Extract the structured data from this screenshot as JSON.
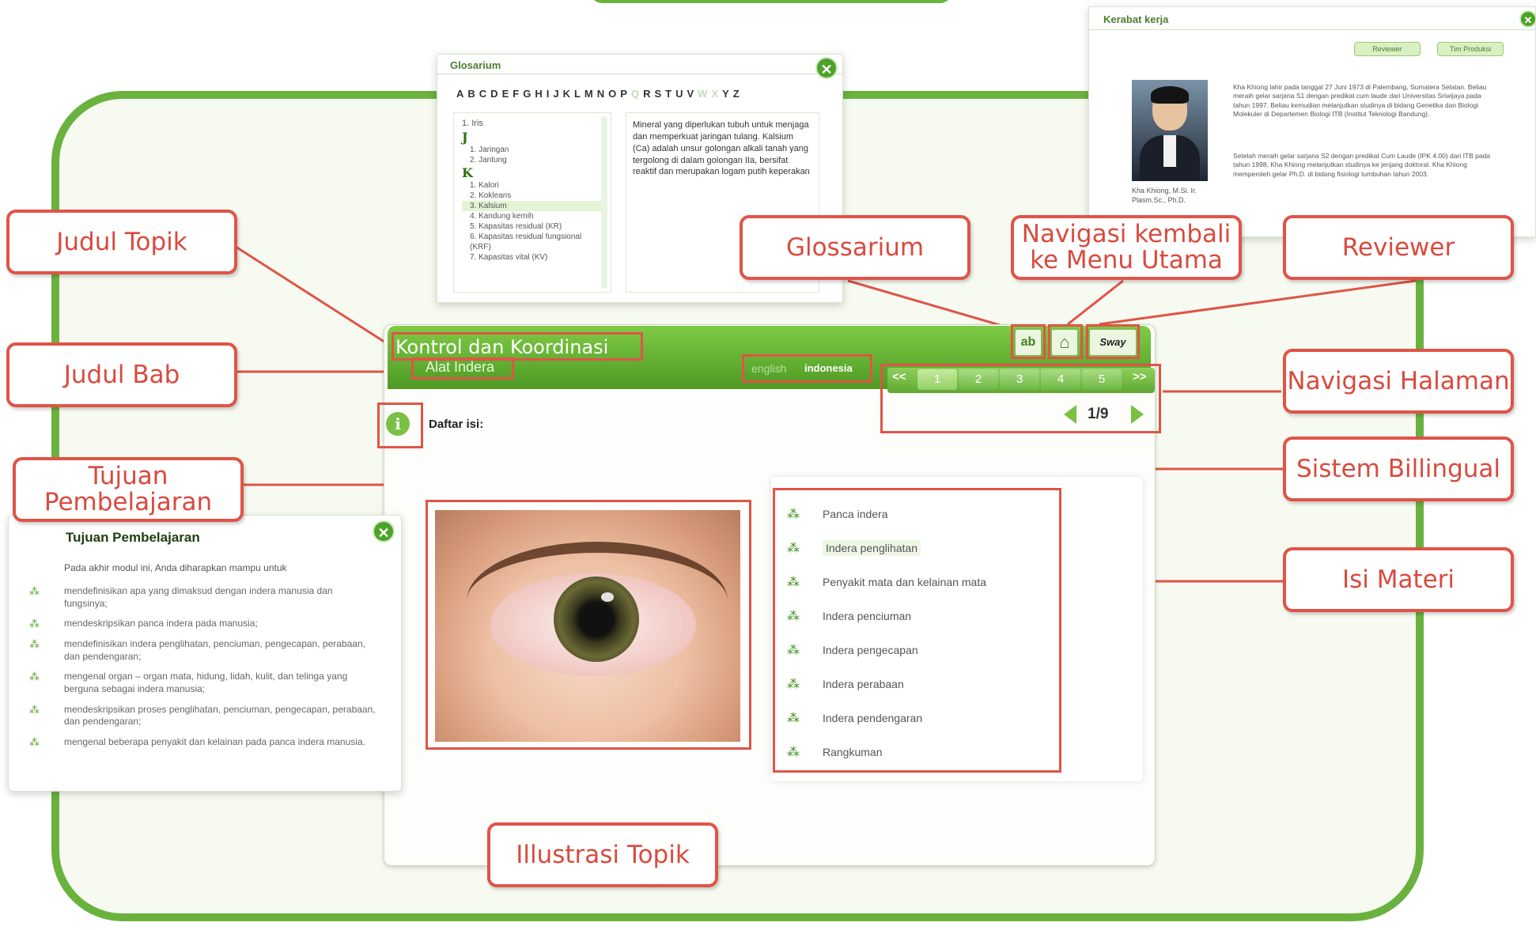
{
  "callouts": {
    "judul_topik": "Judul Topik",
    "judul_bab": "Judul Bab",
    "tujuan": "Tujuan Pembelajaran",
    "glossarium": "Glossarium",
    "navigasi_menu": "Navigasi kembali ke Menu Utama",
    "reviewer": "Reviewer",
    "navigasi_halaman": "Navigasi Halaman",
    "sistem_bilingual": "Sistem Billingual",
    "isi_materi": "Isi Materi",
    "ilustrasi": "Illustrasi Topik"
  },
  "glosarium": {
    "title": "Glosarium",
    "letters": [
      "A",
      "B",
      "C",
      "D",
      "E",
      "F",
      "G",
      "H",
      "I",
      "J",
      "K",
      "L",
      "M",
      "N",
      "O",
      "P",
      "Q",
      "R",
      "S",
      "T",
      "U",
      "V",
      "W",
      "X",
      "Y",
      "Z"
    ],
    "list_top": "1. Iris",
    "group_j": "J",
    "j_items": [
      "1. Jaringan",
      "2. Jantung"
    ],
    "group_k": "K",
    "k_items": [
      "1. Kalori",
      "2. Koklearis",
      "3. Kalsium",
      "4. Kandung kemih",
      "5. Kapasitas residual (KR)",
      "6. Kapasitas residual fungsional (KRF)",
      "7. Kapasitas vital (KV)"
    ],
    "definition": "Mineral yang diperlukan tubuh untuk menjaga dan memperkuat jaringan tulang. Kalsium (Ca) adalah unsur golongan alkali tanah yang tergolong di dalam golongan IIa, bersifat reaktif dan merupakan logam putih keperakan"
  },
  "kerabat": {
    "title": "Kerabat kerja",
    "btn1": "Reviewer",
    "btn2": "Tim Produksi",
    "caption": "Kha Khiong, M.Si. Ir. Plasm.Sc., Ph.D.",
    "bio1": "Kha Khiong lahir pada tanggal 27 Juni 1973 di Palembang, Sumatera Selatan. Beliau meraih gelar sarjana S1 dengan predikat cum laude dari Universitas Sriwijaya pada tahun 1997. Beliau kemudian melanjutkan studinya di bidang Genetika dan Biologi Molekuler di Departemen Biologi ITB (Institut Teknologi Bandung).",
    "bio2": "Setelah meraih gelar sarjana S2 dengan predikat Cum Laude (IPK 4.00) dari ITB pada tahun 1998, Kha Khiong melanjutkan studinya ke jenjang doktoral. Kha Khiong memperoleh gelar Ph.D. di bidang fisiologi tumbuhan tahun 2003."
  },
  "app": {
    "topic_title": "Kontrol dan Koordinasi",
    "chapter_title": "Alat Indera",
    "lang_en": "english",
    "lang_id": "indonesia",
    "toc_label": "Daftar isi:",
    "page_prev": "<<",
    "pages": [
      "1",
      "2",
      "3",
      "4",
      "5"
    ],
    "page_next": ">>",
    "page_count": "1/9",
    "sway_label": "Sway",
    "toc": [
      "Panca indera",
      "Indera penglihatan",
      "Penyakit mata dan kelainan mata",
      "Indera penciuman",
      "Indera pengecapan",
      "Indera perabaan",
      "Indera pendengaran",
      "Rangkuman"
    ]
  },
  "tujuan_panel": {
    "title": "Tujuan Pembelajaran",
    "intro": "Pada akhir modul ini, Anda diharapkan mampu untuk",
    "items": [
      "mendefinisikan apa yang dimaksud dengan indera manusia dan fungsinya;",
      "mendeskripsikan panca indera pada manusia;",
      "mendefinisikan indera penglihatan, penciuman, pengecapan, perabaan, dan pendengaran;",
      "mengenal organ – organ mata, hidung, lidah, kulit, dan telinga yang berguna sebagai indera manusia;",
      "mendeskripsikan proses penglihatan, penciuman, pengecapan, perabaan, dan pendengaran;",
      "mengenal beberapa penyakit dan kelainan pada panca indera manusia."
    ]
  },
  "colors": {
    "accent": "#6ab23e",
    "callout": "#e05447"
  }
}
